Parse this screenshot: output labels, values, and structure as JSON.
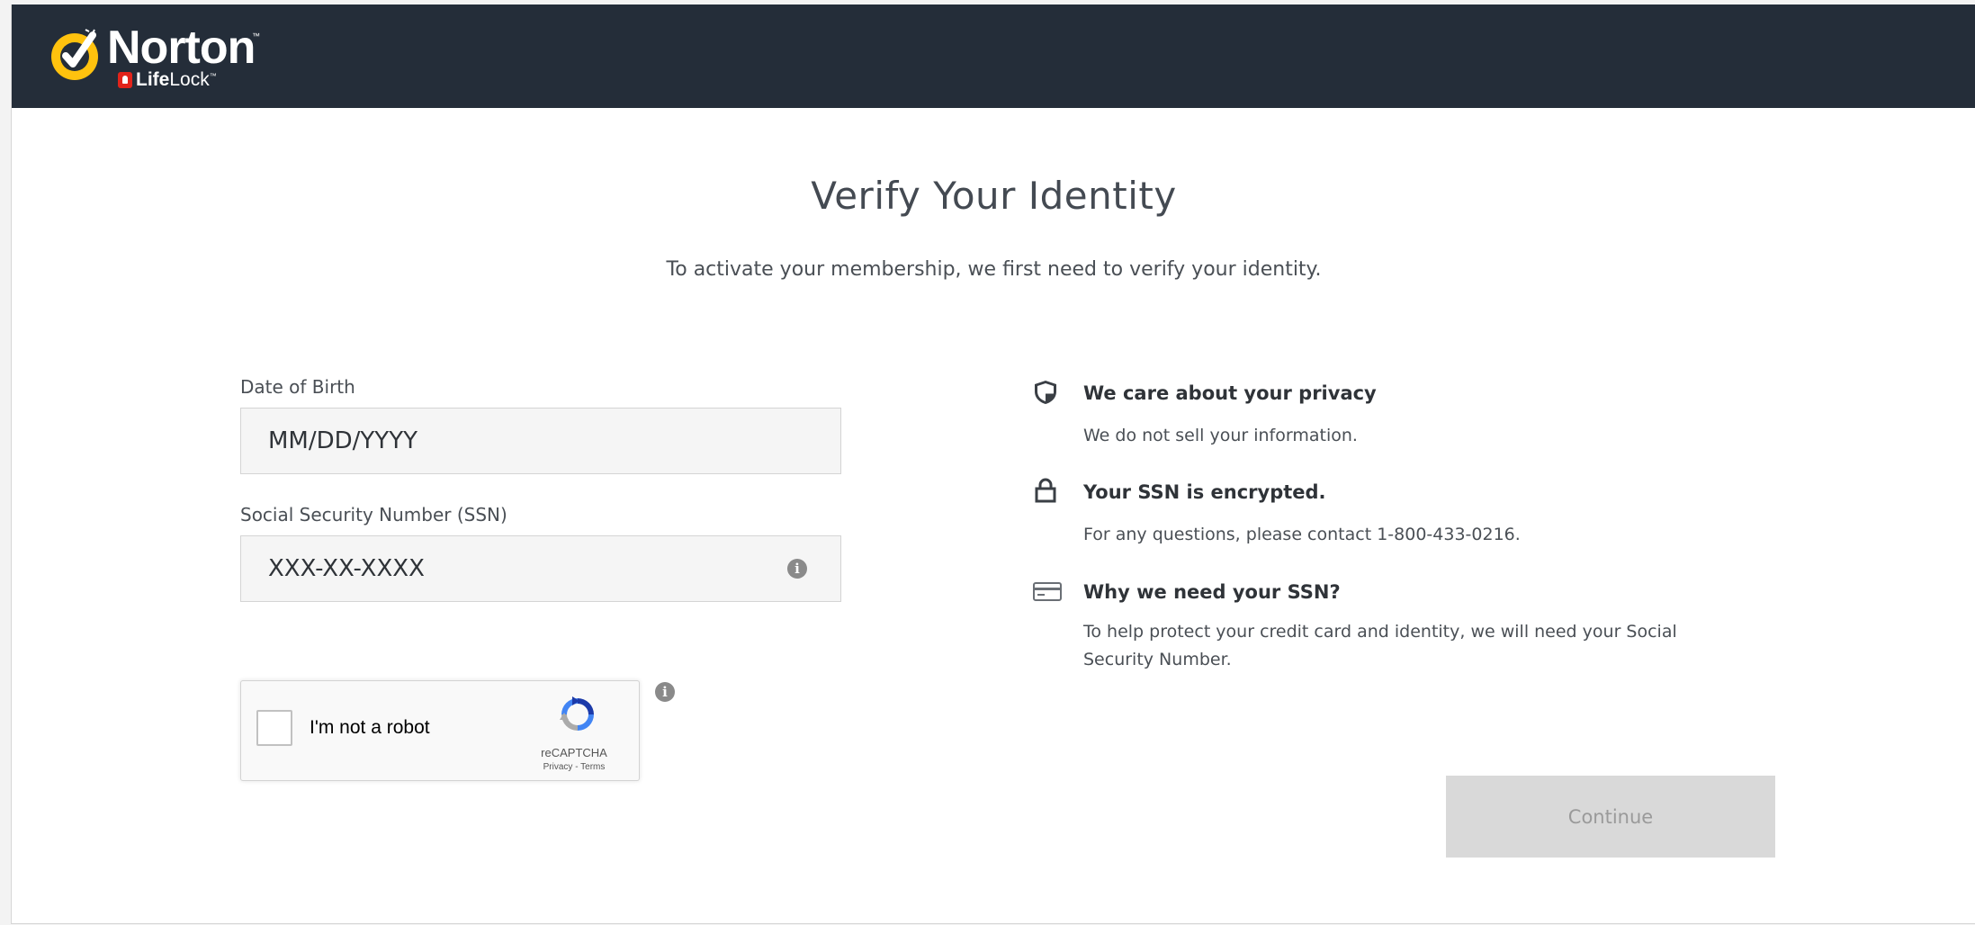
{
  "brand": {
    "name": "Norton",
    "sub_life": "Life",
    "sub_lock": "Lock"
  },
  "page": {
    "title": "Verify Your Identity",
    "subtitle": "To activate your membership, we first need to verify your identity."
  },
  "form": {
    "dob_label": "Date of Birth",
    "dob_placeholder": "MM/DD/YYYY",
    "ssn_label": "Social Security Number (SSN)",
    "ssn_placeholder": "XXX-XX-XXXX"
  },
  "recaptcha": {
    "label": "I'm not a robot",
    "brand": "reCAPTCHA",
    "links": "Privacy - Terms"
  },
  "info": [
    {
      "icon": "shield-icon",
      "heading": "We care about your privacy",
      "text": "We do not sell your information."
    },
    {
      "icon": "lock-icon",
      "heading": "Your SSN is encrypted.",
      "text": "For any questions, please contact 1-800-433-0216."
    },
    {
      "icon": "card-icon",
      "heading": "Why we need your SSN?",
      "text": "To help protect your credit card and identity, we will need your Social Security Number."
    }
  ],
  "actions": {
    "continue_label": "Continue"
  },
  "colors": {
    "header_bg": "#242d39",
    "logo_yellow": "#ffc20e",
    "lifelock_red": "#e2231a",
    "button_disabled_bg": "#d9d9d9",
    "input_bg": "#f5f5f5"
  }
}
